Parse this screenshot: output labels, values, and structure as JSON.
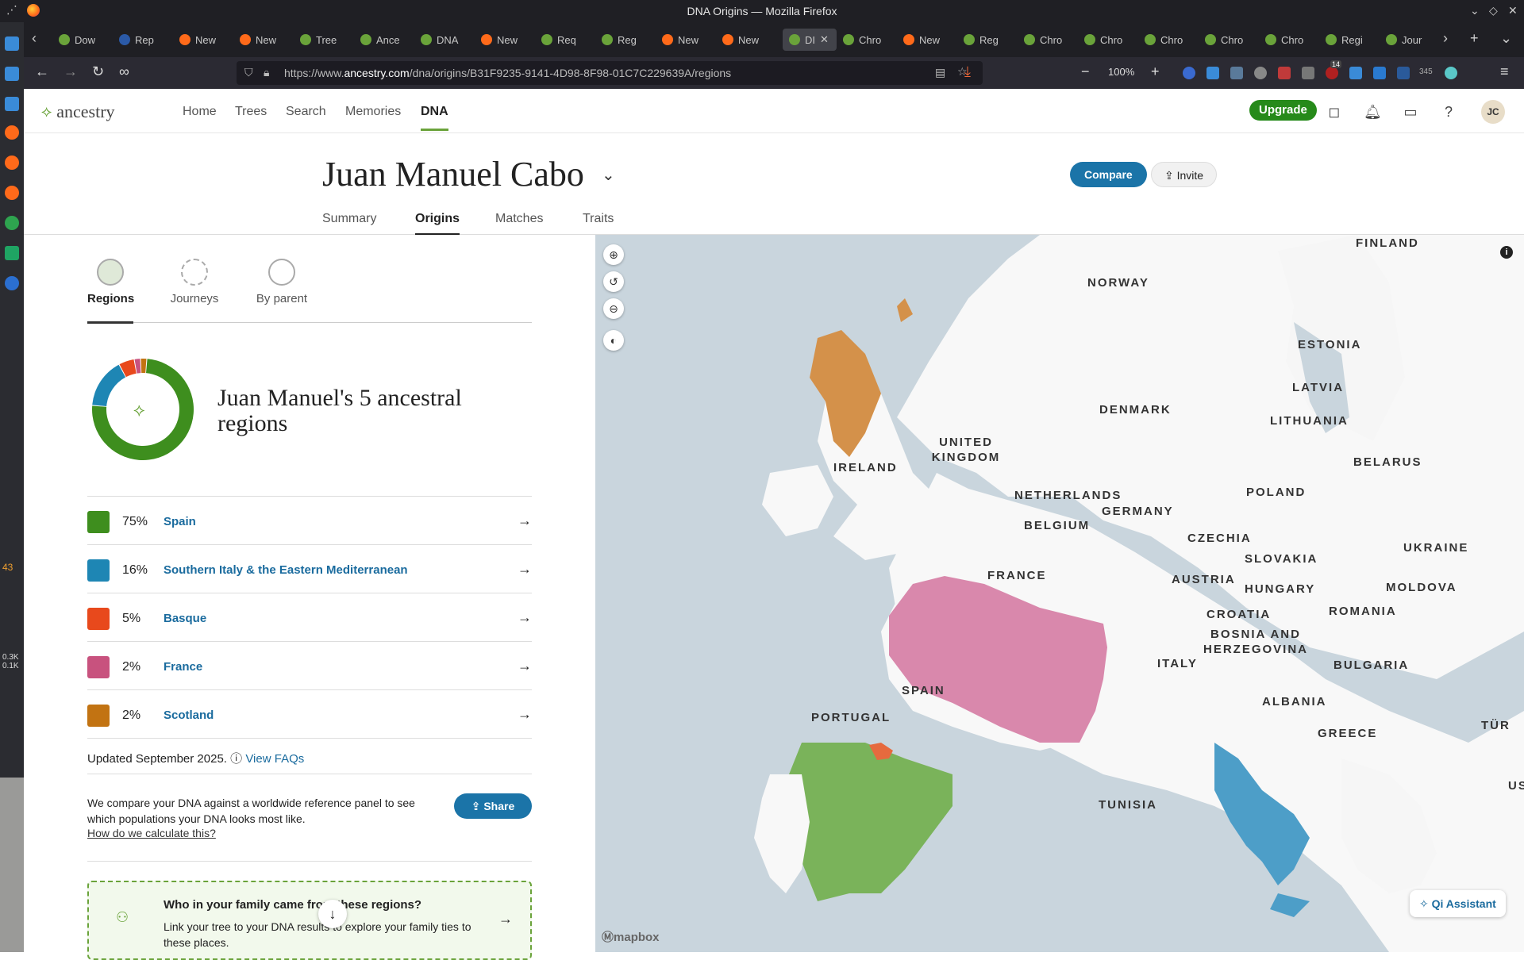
{
  "window": {
    "title": "DNA Origins — Mozilla Firefox"
  },
  "tabs": [
    {
      "label": "Dow",
      "color": "#6aa33a"
    },
    {
      "label": "Rep",
      "color": "#2b5aa8"
    },
    {
      "label": "New",
      "color": "#ff6a1a"
    },
    {
      "label": "New",
      "color": "#ff6a1a"
    },
    {
      "label": "Tree",
      "color": "#6aa33a"
    },
    {
      "label": "Ance",
      "color": "#6aa33a"
    },
    {
      "label": "DNA",
      "color": "#6aa33a"
    },
    {
      "label": "New",
      "color": "#ff6a1a"
    },
    {
      "label": "Req",
      "color": "#6aa33a"
    },
    {
      "label": "Reg",
      "color": "#6aa33a"
    },
    {
      "label": "New",
      "color": "#ff6a1a"
    },
    {
      "label": "New",
      "color": "#ff6a1a"
    },
    {
      "label": "DI",
      "color": "#6aa33a",
      "active": true
    },
    {
      "label": "Chro",
      "color": "#6aa33a"
    },
    {
      "label": "New",
      "color": "#ff6a1a"
    },
    {
      "label": "Reg",
      "color": "#6aa33a"
    },
    {
      "label": "Chro",
      "color": "#6aa33a"
    },
    {
      "label": "Chro",
      "color": "#6aa33a"
    },
    {
      "label": "Chro",
      "color": "#6aa33a"
    },
    {
      "label": "Chro",
      "color": "#6aa33a"
    },
    {
      "label": "Chro",
      "color": "#6aa33a"
    },
    {
      "label": "Regi",
      "color": "#6aa33a"
    },
    {
      "label": "Jour",
      "color": "#6aa33a"
    }
  ],
  "browser": {
    "url_prefix": "https://www.",
    "url_domain": "ancestry.com",
    "url_path": "/dna/origins/B31F9235-9141-4D98-8F98-01C7C229639A/regions",
    "zoom": "100%",
    "notif_badge": "14",
    "ext_count": "345"
  },
  "os": {
    "counter": "43",
    "net_up": "0.3K",
    "net_down": "0.1K"
  },
  "site": {
    "logo": "ancestry",
    "nav": [
      "Home",
      "Trees",
      "Search",
      "Memories",
      "DNA"
    ],
    "upgrade": "Upgrade",
    "avatar": "JC"
  },
  "profile": {
    "name": "Juan Manuel Cabo",
    "compare": "Compare",
    "invite": "Invite",
    "subtabs": [
      "Summary",
      "Origins",
      "Matches",
      "Traits"
    ]
  },
  "view_tabs": [
    "Regions",
    "Journeys",
    "By parent"
  ],
  "summary_title": "Juan Manuel's 5 ancestral regions",
  "regions": [
    {
      "pct": "75%",
      "value": 75,
      "name": "Spain",
      "color": "#3e8e1e"
    },
    {
      "pct": "16%",
      "value": 16,
      "name": "Southern Italy & the Eastern Mediterranean",
      "color": "#1e86b4"
    },
    {
      "pct": "5%",
      "value": 5,
      "name": "Basque",
      "color": "#e8491c"
    },
    {
      "pct": "2%",
      "value": 2,
      "name": "France",
      "color": "#c8527e"
    },
    {
      "pct": "2%",
      "value": 2,
      "name": "Scotland",
      "color": "#c27312"
    }
  ],
  "updated": "Updated September 2025.",
  "view_faqs": "View FAQs",
  "compare_text": "We compare your DNA against a worldwide reference panel to see which populations your DNA looks most like.",
  "how_link": "How do we calculate this?",
  "share": "Share",
  "family_card": {
    "title": "Who in your family came from these regions?",
    "desc": "Link your tree to your DNA results to explore your family ties to these places."
  },
  "map": {
    "labels": [
      "FINLAND",
      "NORWAY",
      "ESTONIA",
      "LATVIA",
      "DENMARK",
      "LITHUANIA",
      "UNITED KINGDOM",
      "IRELAND",
      "BELARUS",
      "NETHERLANDS",
      "POLAND",
      "GERMANY",
      "BELGIUM",
      "CZECHIA",
      "UKRAINE",
      "SLOVAKIA",
      "FRANCE",
      "AUSTRIA",
      "MOLDOVA",
      "HUNGARY",
      "ROMANIA",
      "CROATIA",
      "BOSNIA AND HERZEGOVINA",
      "ITALY",
      "BULGARIA",
      "SPAIN",
      "ALBANIA",
      "PORTUGAL",
      "GREECE",
      "TÜR",
      "TUNISIA",
      "US"
    ],
    "attribution": "mapbox",
    "assistant": "Qi Assistant"
  }
}
